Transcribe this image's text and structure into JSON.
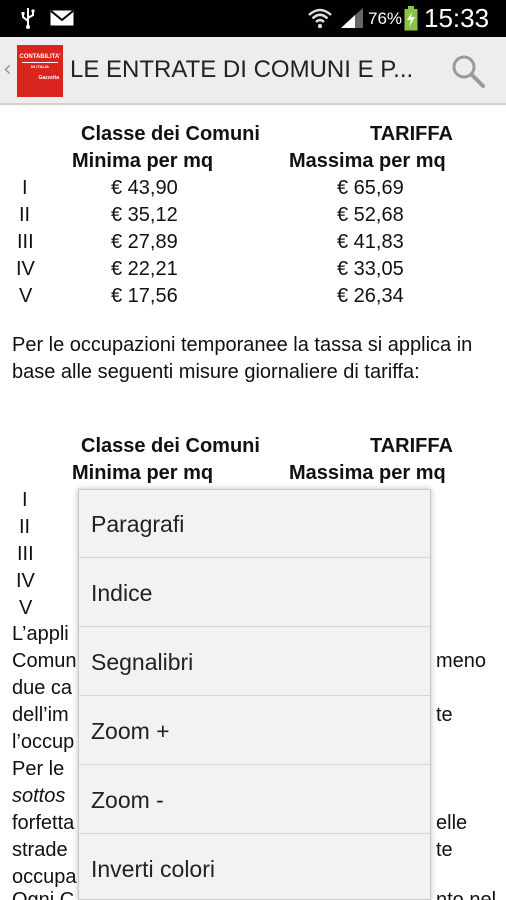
{
  "status_bar": {
    "battery_percent": "76%",
    "time": "15:33",
    "icons": [
      "usb-icon",
      "mail-icon",
      "wifi-icon",
      "signal-icon",
      "battery-charging-icon"
    ]
  },
  "action_bar": {
    "logo_lines": [
      "CONTABILITA'",
      "IN ITALIA",
      "Gazzetta"
    ],
    "title": "LE ENTRATE DI COMUNI E P...",
    "icons": [
      "back-chevron-icon",
      "search-icon"
    ]
  },
  "table1": {
    "header_col1_line1": "Classe dei Comuni",
    "header_col1_line2": "Minima per mq",
    "header_col2_line1": "TARIFFA",
    "header_col2_line2": "Massima per mq",
    "rows": [
      {
        "cls": "I",
        "min": "€ 43,90",
        "max": "€ 65,69"
      },
      {
        "cls": "II",
        "min": "€ 35,12",
        "max": "€ 52,68"
      },
      {
        "cls": "III",
        "min": "€ 27,89",
        "max": "€ 41,83"
      },
      {
        "cls": "IV",
        "min": "€ 22,21",
        "max": "€ 33,05"
      },
      {
        "cls": "V",
        "min": "€ 17,56",
        "max": "€ 26,34"
      }
    ]
  },
  "paragraph1": "Per le occupazioni temporanee la tassa si applica in base alle seguenti misure giornaliere di tariffa:",
  "table2": {
    "header_col1_line1": "Classe dei Comuni",
    "header_col1_line2": "Minima per mq",
    "header_col2_line1": "TARIFFA",
    "header_col2_line2": "Massima per mq",
    "row_classes": [
      "I",
      "II",
      "III",
      "IV",
      "V"
    ]
  },
  "obscured_text": {
    "left_fragments": [
      "L’appli",
      "Comun",
      "due ca",
      "dell’im",
      "l’occup",
      "Per le",
      "sottos",
      "forfetta",
      "strade",
      "occupa",
      "Ogni C"
    ],
    "right_fragments": [
      {
        "line": 1,
        "text": "meno"
      },
      {
        "line": 3,
        "text": "te"
      },
      {
        "line": 8,
        "text": "elle"
      },
      {
        "line": 9,
        "text": "te"
      },
      {
        "line": 10,
        "text": "nto nel"
      }
    ]
  },
  "menu": {
    "items": [
      "Paragrafi",
      "Indice",
      "Segnalibri",
      "Zoom +",
      "Zoom -",
      "Inverti colori"
    ]
  }
}
